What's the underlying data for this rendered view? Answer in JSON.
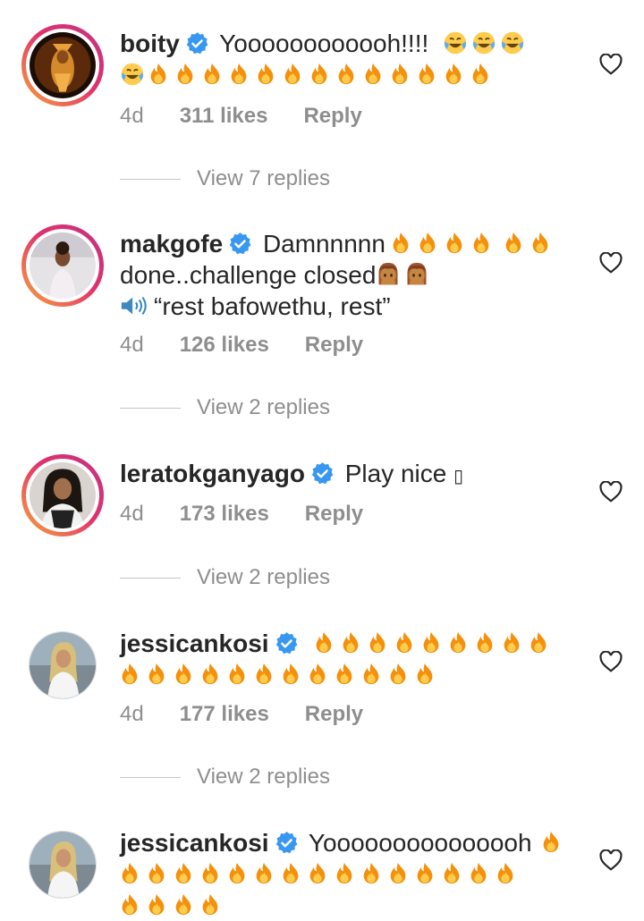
{
  "comments": [
    {
      "username": "boity",
      "text": "Yoooooooooooh!!!!",
      "time": "4d",
      "likes": "311 likes",
      "reply": "Reply",
      "view_replies": "View 7 replies",
      "avatar_icon": "avatar-photo",
      "emojis": [
        "face-with-tears-of-joy",
        "fire"
      ]
    },
    {
      "username": "makgofe",
      "text": "Damnnnnn",
      "line2": "done..challenge closed",
      "line3": "“rest bafowethu, rest”",
      "time": "4d",
      "likes": "126 likes",
      "reply": "Reply",
      "view_replies": "View 2 replies",
      "emojis": [
        "fire",
        "woman-facepalming-face",
        "speaker-high-volume"
      ]
    },
    {
      "username": "leratokganyago",
      "text": "Play nice",
      "unsupported_glyph": "▯",
      "time": "4d",
      "likes": "173 likes",
      "reply": "Reply",
      "view_replies": "View 2 replies"
    },
    {
      "username": "jessicankosi",
      "text": "",
      "time": "4d",
      "likes": "177 likes",
      "reply": "Reply",
      "view_replies": "View 2 replies",
      "emojis": [
        "fire"
      ]
    },
    {
      "username": "jessicankosi",
      "text": "Yooooooooooooooh",
      "emojis": [
        "fire"
      ]
    }
  ],
  "colors": {
    "text": "#262626",
    "secondary": "#8e8e8e",
    "verified": "#3897f0",
    "fire_orange": "#f4900c",
    "fire_yellow": "#ffcc4d"
  }
}
